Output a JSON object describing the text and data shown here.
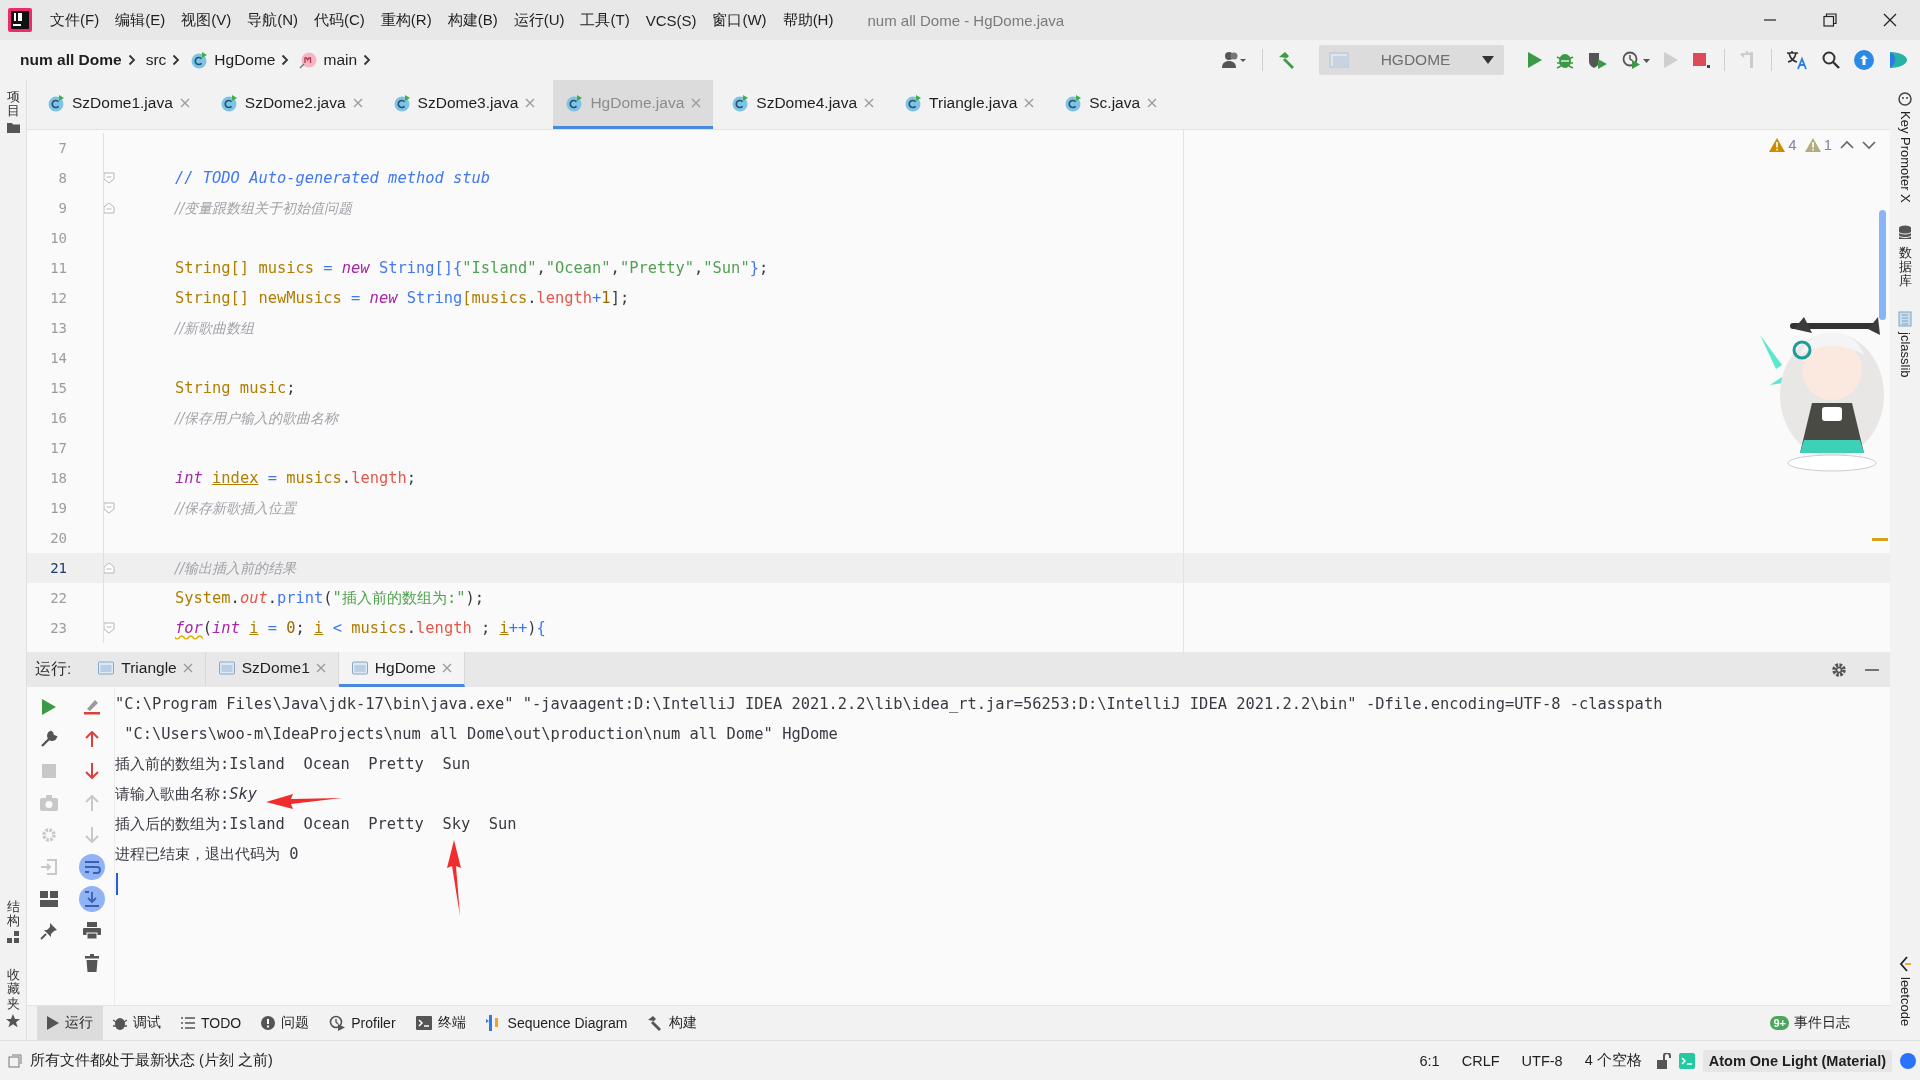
{
  "window": {
    "title": "num all Dome - HgDome.java"
  },
  "menu": [
    "文件(F)",
    "编辑(E)",
    "视图(V)",
    "导航(N)",
    "代码(C)",
    "重构(R)",
    "构建(B)",
    "运行(U)",
    "工具(T)",
    "VCS(S)",
    "窗口(W)",
    "帮助(H)"
  ],
  "breadcrumb": [
    {
      "text": "num all Dome",
      "kind": "project"
    },
    {
      "text": "src",
      "kind": "folder"
    },
    {
      "text": "HgDome",
      "kind": "class"
    },
    {
      "text": "main",
      "kind": "method"
    }
  ],
  "run_config": {
    "label": "HGDOME"
  },
  "left_strip": {
    "top": [
      "项目"
    ],
    "bottom": [
      "结构",
      "收藏夹"
    ]
  },
  "right_strip": {
    "top": [
      "Key Promoter X",
      "数据库",
      "jclasslib"
    ],
    "bottom": [
      "leetcode"
    ]
  },
  "editor_tabs": [
    {
      "label": "SzDome1.java",
      "selected": false
    },
    {
      "label": "SzDome2.java",
      "selected": false
    },
    {
      "label": "SzDome3.java",
      "selected": false
    },
    {
      "label": "HgDome.java",
      "selected": true
    },
    {
      "label": "SzDome4.java",
      "selected": false
    },
    {
      "label": "Triangle.java",
      "selected": false
    },
    {
      "label": "Sc.java",
      "selected": false
    }
  ],
  "inspections": {
    "warnings": "4",
    "weak_warnings": "1"
  },
  "code_lines": [
    {
      "number": "7",
      "current": false
    },
    {
      "number": "8",
      "current": false,
      "fold": {
        "kind": "start"
      },
      "tokens": [
        {
          "text": "// TODO Auto-generated method stub",
          "kind": "todo"
        }
      ]
    },
    {
      "number": "9",
      "current": false,
      "fold": {
        "kind": "end"
      },
      "tokens": [
        {
          "text": "//变量跟数组关于初始值问题",
          "kind": "cmt"
        }
      ]
    },
    {
      "number": "10",
      "current": false
    },
    {
      "number": "11",
      "current": false,
      "tokens": [
        {
          "text": "String[] musics ",
          "kind": "var"
        },
        {
          "text": "= ",
          "kind": "op"
        },
        {
          "text": "new ",
          "kind": "kw"
        },
        {
          "text": "String[]",
          "kind": "fn"
        },
        {
          "text": "{",
          "kind": "fn"
        },
        {
          "text": "\"Island\"",
          "kind": "str"
        },
        {
          "text": ",",
          "kind": "plain"
        },
        {
          "text": "\"Ocean\"",
          "kind": "str"
        },
        {
          "text": ",",
          "kind": "plain"
        },
        {
          "text": "\"Pretty\"",
          "kind": "str"
        },
        {
          "text": ",",
          "kind": "plain"
        },
        {
          "text": "\"Sun\"",
          "kind": "str"
        },
        {
          "text": "}",
          "kind": "fn"
        },
        {
          "text": ";",
          "kind": "plain"
        }
      ]
    },
    {
      "number": "12",
      "current": false,
      "tokens": [
        {
          "text": "String[] newMusics ",
          "kind": "var"
        },
        {
          "text": "= ",
          "kind": "op"
        },
        {
          "text": "new ",
          "kind": "kw"
        },
        {
          "text": "String",
          "kind": "fn"
        },
        {
          "text": "[musics",
          "kind": "var"
        },
        {
          "text": ".",
          "kind": "plain"
        },
        {
          "text": "length",
          "kind": "field"
        },
        {
          "text": "+",
          "kind": "op"
        },
        {
          "text": "1",
          "kind": "num"
        },
        {
          "text": "];",
          "kind": "plain"
        }
      ]
    },
    {
      "number": "13",
      "current": false,
      "tokens": [
        {
          "text": "//新歌曲数组",
          "kind": "cmt"
        }
      ]
    },
    {
      "number": "14",
      "current": false
    },
    {
      "number": "15",
      "current": false,
      "tokens": [
        {
          "text": "String music",
          "kind": "var"
        },
        {
          "text": ";",
          "kind": "plain"
        }
      ]
    },
    {
      "number": "16",
      "current": false,
      "tokens": [
        {
          "text": "//保存用户输入的歌曲名称",
          "kind": "cmt"
        }
      ]
    },
    {
      "number": "17",
      "current": false
    },
    {
      "number": "18",
      "current": false,
      "tokens": [
        {
          "text": "int ",
          "kind": "kw"
        },
        {
          "text": "index",
          "kind": "under"
        },
        {
          "text": " = ",
          "kind": "op"
        },
        {
          "text": "musics",
          "kind": "var"
        },
        {
          "text": ".",
          "kind": "plain"
        },
        {
          "text": "length",
          "kind": "field"
        },
        {
          "text": ";",
          "kind": "plain"
        }
      ]
    },
    {
      "number": "19",
      "current": false,
      "fold": {
        "kind": "start"
      },
      "tokens": [
        {
          "text": "//保存新歌插入位置",
          "kind": "cmt"
        }
      ]
    },
    {
      "number": "20",
      "current": false
    },
    {
      "number": "21",
      "current": true,
      "fold": {
        "kind": "end"
      },
      "tokens": [
        {
          "text": "//输出插入前的结果",
          "kind": "cmt"
        }
      ]
    },
    {
      "number": "22",
      "current": false,
      "tokens": [
        {
          "text": "System",
          "kind": "var"
        },
        {
          "text": ".",
          "kind": "plain"
        },
        {
          "text": "out",
          "kind": "field-i"
        },
        {
          "text": ".",
          "kind": "plain"
        },
        {
          "text": "print",
          "kind": "fn"
        },
        {
          "text": "(",
          "kind": "plain"
        },
        {
          "text": "\"插入前的数组为:\"",
          "kind": "str"
        },
        {
          "text": ");",
          "kind": "plain"
        }
      ]
    },
    {
      "number": "23",
      "current": false,
      "fold": {
        "kind": "start"
      },
      "tokens": [
        {
          "text": "for",
          "kind": "kw-warn"
        },
        {
          "text": "(",
          "kind": "plain"
        },
        {
          "text": "int ",
          "kind": "kw"
        },
        {
          "text": "i",
          "kind": "under"
        },
        {
          "text": " = ",
          "kind": "op"
        },
        {
          "text": "0",
          "kind": "num"
        },
        {
          "text": "; ",
          "kind": "plain"
        },
        {
          "text": "i",
          "kind": "under"
        },
        {
          "text": " < ",
          "kind": "op"
        },
        {
          "text": "musics",
          "kind": "var"
        },
        {
          "text": ".",
          "kind": "plain"
        },
        {
          "text": "length",
          "kind": "field"
        },
        {
          "text": " ; ",
          "kind": "plain"
        },
        {
          "text": "i",
          "kind": "under"
        },
        {
          "text": "++",
          "kind": "op"
        },
        {
          "text": ")",
          "kind": "plain"
        },
        {
          "text": "{",
          "kind": "fn"
        }
      ]
    }
  ],
  "run_panel": {
    "label": "运行:",
    "tabs": [
      {
        "label": "Triangle",
        "selected": false
      },
      {
        "label": "SzDome1",
        "selected": false
      },
      {
        "label": "HgDome",
        "selected": true
      }
    ],
    "console": [
      "\"C:\\Program Files\\Java\\jdk-17\\bin\\java.exe\" \"-javaagent:D:\\IntelliJ IDEA 2021.2.2\\lib\\idea_rt.jar=56253:D:\\IntelliJ IDEA 2021.2.2\\bin\" -Dfile.encoding=UTF-8 -classpath",
      " \"C:\\Users\\woo-m\\IdeaProjects\\num all Dome\\out\\production\\num all Dome\" HgDome",
      "插入前的数组为:Island  Ocean  Pretty  Sun",
      "请输入歌曲名称:*Sky*",
      "插入后的数组为:Island  Ocean  Pretty  Sky  Sun",
      "进程已结束，退出代码为 0"
    ],
    "input_caret": true
  },
  "tool_windows": [
    {
      "label": "运行",
      "kind": "run",
      "selected": true
    },
    {
      "label": "调试",
      "kind": "debug",
      "selected": false
    },
    {
      "label": "TODO",
      "kind": "todo",
      "selected": false
    },
    {
      "label": "问题",
      "kind": "problems",
      "selected": false
    },
    {
      "label": "Profiler",
      "kind": "profiler",
      "selected": false
    },
    {
      "label": "终端",
      "kind": "terminal",
      "selected": false
    },
    {
      "label": "Sequence Diagram",
      "kind": "sequence",
      "selected": false
    },
    {
      "label": "构建",
      "kind": "build",
      "selected": false
    }
  ],
  "event_log": {
    "label": "事件日志",
    "badge": "9+"
  },
  "status_bar": {
    "message": "所有文件都处于最新状态 (片刻 之前)",
    "items": [
      "6:1",
      "CRLF",
      "UTF-8",
      "4 个空格"
    ],
    "theme": "Atom One Light (Material)"
  }
}
